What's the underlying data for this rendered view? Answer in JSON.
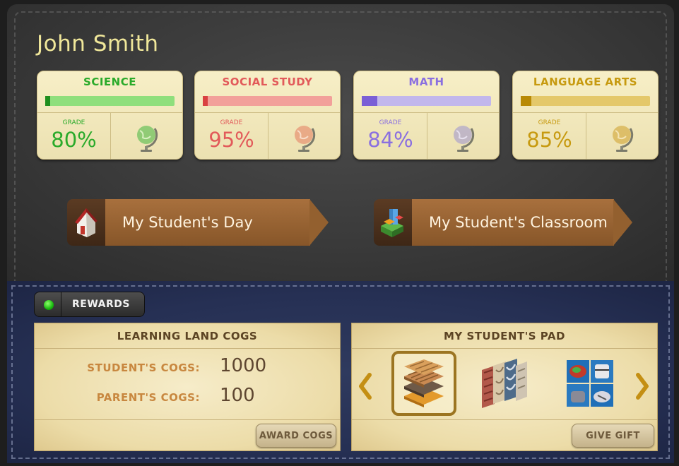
{
  "student": {
    "name": "John Smith"
  },
  "subjects": [
    {
      "title": "SCIENCE",
      "grade_label": "GRADE",
      "grade": "80%",
      "progress": 0.04,
      "color": "#2aaa2a",
      "track": "#8fdf7c",
      "globe_color": "#7fc76a",
      "icon": "globe-icon"
    },
    {
      "title": "SOCIAL STUDY",
      "grade_label": "GRADE",
      "grade": "95%",
      "progress": 0.04,
      "color": "#e25a5a",
      "track": "#f2a09a",
      "globe_color": "#e8a07e",
      "icon": "globe-icon"
    },
    {
      "title": "MATH",
      "grade_label": "GRADE",
      "grade": "84%",
      "progress": 0.12,
      "color": "#8a6fe0",
      "track": "#c2b7ec",
      "globe_color": "#b8afc8",
      "icon": "globe-icon"
    },
    {
      "title": "LANGUAGE ARTS",
      "grade_label": "GRADE",
      "grade": "85%",
      "progress": 0.08,
      "color": "#c79a10",
      "track": "#e4c86a",
      "globe_color": "#d9b75a",
      "icon": "globe-icon"
    }
  ],
  "actions": {
    "day_label": "My Student's Day",
    "day_icon": "house-icon",
    "classroom_label": "My Student's Classroom",
    "classroom_icon": "classroom-blocks-icon"
  },
  "rewards": {
    "toggle_label": "REWARDS",
    "led_color": "#18b80e"
  },
  "cogs_panel": {
    "title": "LEARNING LAND COGS",
    "student_label": "STUDENT'S COGS:",
    "student_value": "1000",
    "parent_label": "PARENT'S COGS:",
    "parent_value": "100",
    "button_label": "AWARD COGS"
  },
  "pad_panel": {
    "title": "MY STUDENT'S PAD",
    "items": [
      {
        "icon": "layered-tiles-icon",
        "selected": true
      },
      {
        "icon": "wallpaper-swatches-icon",
        "selected": false
      },
      {
        "icon": "furniture-set-icon",
        "selected": false
      }
    ],
    "button_label": "GIVE GIFT"
  },
  "colors": {
    "name_text": "#f0e79a",
    "card_bg": "#f7efc7",
    "button_brown": "#a8703d",
    "accent_gold": "#c48f13"
  }
}
